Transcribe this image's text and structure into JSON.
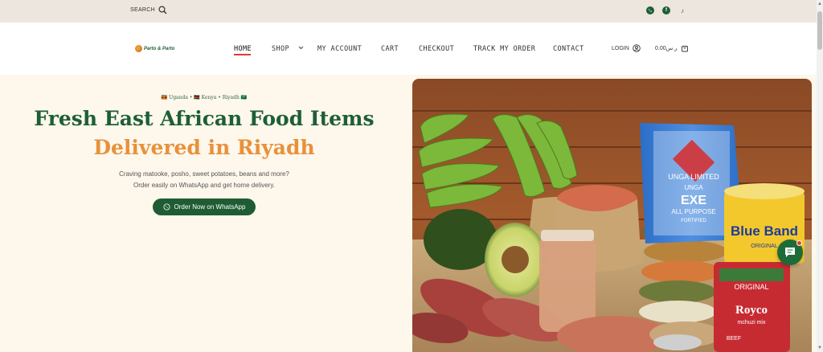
{
  "topbar": {
    "search_label": "SEARCH",
    "social_icons": [
      "whatsapp-icon",
      "facebook-icon",
      "tiktok-icon"
    ],
    "bg_color": "#ece6df"
  },
  "header": {
    "logo_text": "Parto & Parto",
    "nav": [
      {
        "label": "HOME",
        "active": true
      },
      {
        "label": "SHOP",
        "has_dropdown": true
      },
      {
        "label": "MY ACCOUNT"
      },
      {
        "label": "CART"
      },
      {
        "label": "CHECKOUT"
      },
      {
        "label": "TRACK MY ORDER"
      },
      {
        "label": "CONTACT"
      }
    ],
    "login_label": "LOGIN",
    "cart_total": "0.00ر.س",
    "active_underline_color": "#e23b2e"
  },
  "hero": {
    "tagline": "🇺🇬 Uganda • 🇰🇪 Kenya • Riyadh 🇸🇦",
    "title_line1": "Fresh East African Food Items",
    "title_line2": "Delivered in Riyadh",
    "description_line1": "Craving matooke, posho, sweet potatoes, beans and more?",
    "description_line2": "Order easily on WhatsApp and get home delivery.",
    "cta_label": "Order Now on WhatsApp",
    "colors": {
      "primary_green": "#1e5f35",
      "accent_orange": "#e8913a",
      "hero_bg": "#fdf7ec"
    }
  },
  "product_image": {
    "products": [
      "green bananas (matooke)",
      "avocado",
      "sweet potatoes",
      "peanuts",
      "beans",
      "lentils",
      "rice",
      "posho flour",
      "margarine tub",
      "mchuzi mix"
    ],
    "unga_brand": "UNGA LIMITED",
    "unga_name": "UNGA",
    "unga_product": "EXE",
    "unga_sub": "ALL PURPOSE",
    "unga_fortified": "FORTIFIED",
    "blueband_brand": "Blue Band",
    "blueband_sub": "ORIGINAL",
    "royco_original": "ORIGINAL",
    "royco_brand": "Royco",
    "royco_mix": "mchuzi mix",
    "royco_beef": "BEEF"
  },
  "chat_widget": {
    "icon": "chat-icon",
    "color": "#1e6b3a"
  }
}
